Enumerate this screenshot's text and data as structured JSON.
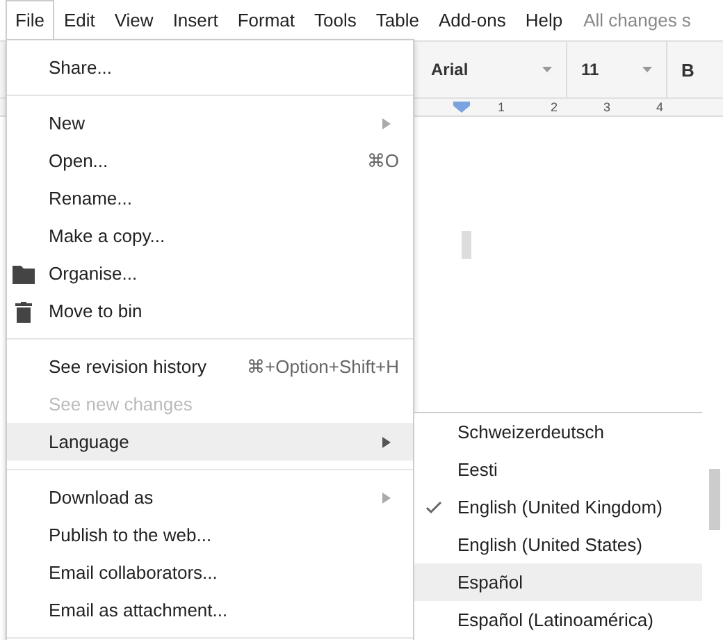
{
  "menubar": [
    {
      "label": "File",
      "selected": true
    },
    {
      "label": "Edit",
      "selected": false
    },
    {
      "label": "View",
      "selected": false
    },
    {
      "label": "Insert",
      "selected": false
    },
    {
      "label": "Format",
      "selected": false
    },
    {
      "label": "Tools",
      "selected": false
    },
    {
      "label": "Table",
      "selected": false
    },
    {
      "label": "Add-ons",
      "selected": false
    },
    {
      "label": "Help",
      "selected": false
    }
  ],
  "save_status": "All changes s",
  "toolbar": {
    "font": "Arial",
    "font_size": "11",
    "bold": "B"
  },
  "ruler": [
    "1",
    "2",
    "3",
    "4"
  ],
  "file_menu": [
    [
      {
        "label": "Share...",
        "disabled": false,
        "selected": false
      }
    ],
    [
      {
        "label": "New",
        "submenu": true,
        "disabled": false,
        "selected": false
      },
      {
        "label": "Open...",
        "shortcut": "⌘O",
        "disabled": false,
        "selected": false
      },
      {
        "label": "Rename...",
        "disabled": false,
        "selected": false
      },
      {
        "label": "Make a copy...",
        "disabled": false,
        "selected": false
      },
      {
        "label": "Organise...",
        "kind": "folder",
        "disabled": false,
        "selected": false
      },
      {
        "label": "Move to bin",
        "kind": "trash",
        "disabled": false,
        "selected": false
      }
    ],
    [
      {
        "label": "See revision history",
        "shortcut": "⌘+Option+Shift+H",
        "disabled": false,
        "selected": false
      },
      {
        "label": "See new changes",
        "disabled": true,
        "selected": false
      },
      {
        "label": "Language",
        "submenu": true,
        "disabled": false,
        "selected": true
      }
    ],
    [
      {
        "label": "Download as",
        "submenu": true,
        "disabled": false,
        "selected": false
      },
      {
        "label": "Publish to the web...",
        "disabled": false,
        "selected": false
      },
      {
        "label": "Email collaborators...",
        "disabled": false,
        "selected": false
      },
      {
        "label": "Email as attachment...",
        "disabled": false,
        "selected": false
      }
    ]
  ],
  "language_menu": [
    {
      "label": "Schweizerdeutsch",
      "checked": false,
      "selected": false
    },
    {
      "label": "Eesti",
      "checked": false,
      "selected": false
    },
    {
      "label": "English (United Kingdom)",
      "checked": true,
      "selected": false
    },
    {
      "label": "English (United States)",
      "checked": false,
      "selected": false
    },
    {
      "label": "Español",
      "checked": false,
      "selected": true
    },
    {
      "label": "Español (Latinoamérica)",
      "checked": false,
      "selected": false
    }
  ]
}
